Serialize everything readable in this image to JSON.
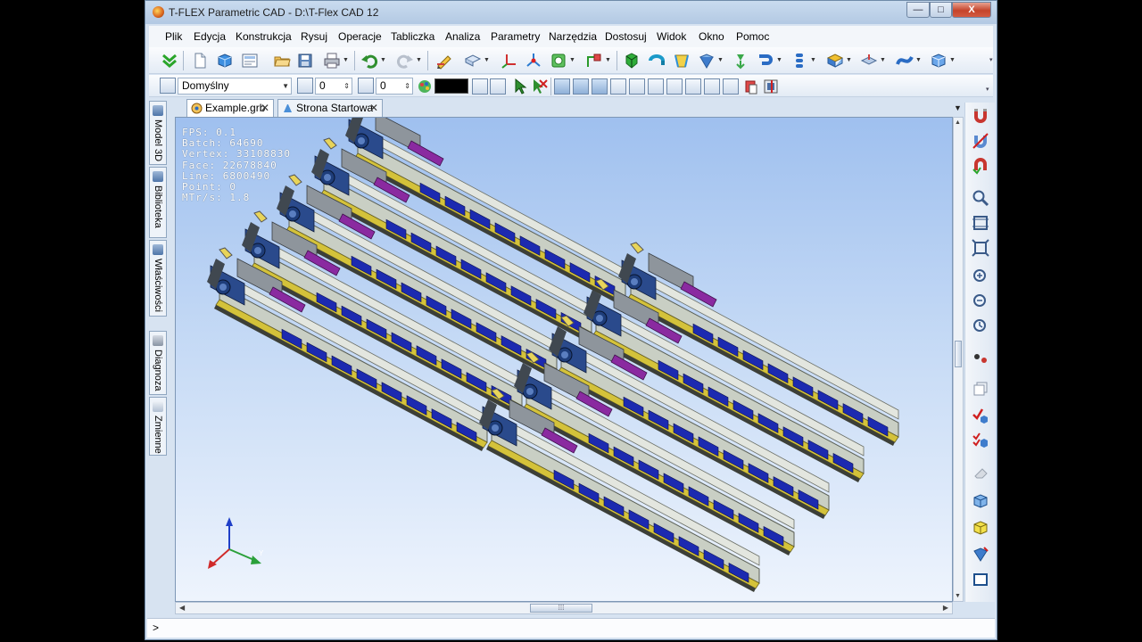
{
  "window": {
    "title": "T-FLEX Parametric CAD - D:\\T-Flex CAD 12",
    "controls": {
      "minimize": "—",
      "maximize": "□",
      "close": "X"
    }
  },
  "menu": [
    "Plik",
    "Edycja",
    "Konstrukcja",
    "Rysuj",
    "Operacje",
    "Tabliczka",
    "Analiza",
    "Parametry",
    "Narzędzia",
    "Dostosuj",
    "Widok",
    "Okno",
    "Pomoc"
  ],
  "toolbar2": {
    "layer_combo": "Domyślny",
    "priority_value": "0",
    "level_value": "0",
    "color": "#000000"
  },
  "tabs": [
    {
      "label": "Example.grb",
      "close": "✕"
    },
    {
      "label": "Strona Startowa",
      "close": "✕"
    }
  ],
  "left_panel": [
    "Model 3D",
    "Biblioteka",
    "Właściwości",
    "Diagnoza",
    "Zmienne"
  ],
  "viewport": {
    "stats": [
      "FPS: 0.1",
      "Batch: 64690",
      "Vertex: 33108830",
      "Face: 22678840",
      "Line: 6800490",
      "Point: 0",
      "MTr/s: 1.8"
    ],
    "axis_labels": {
      "y": "Y"
    },
    "background_top": "#9fc0ef",
    "background_bottom": "#eef4fd"
  },
  "statusbar": {
    "prompt": ">"
  }
}
